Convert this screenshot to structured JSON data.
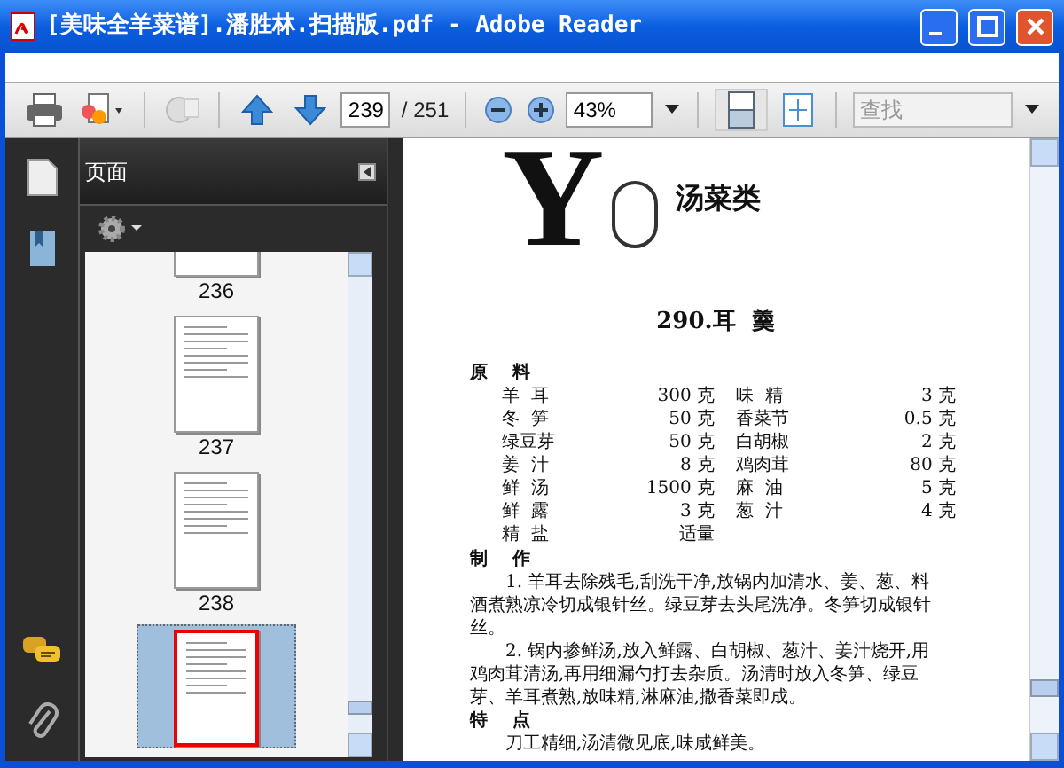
{
  "window": {
    "title": "[美味全羊菜谱].潘胜林.扫描版.pdf - Adobe Reader"
  },
  "toolbar": {
    "page": "239",
    "page_total": "/ 251",
    "zoom": "43%",
    "search": {
      "placeholder": "查找"
    }
  },
  "panel": {
    "title": "页面",
    "thumbnails": [
      {
        "label": "236",
        "selected": false
      },
      {
        "label": "237",
        "selected": false
      },
      {
        "label": "238",
        "selected": false
      },
      {
        "selected": true
      }
    ]
  },
  "document": {
    "initial": "Y",
    "section": "汤菜类",
    "recipe_title": "290.耳  羹",
    "ingredients_heading": "原    料",
    "ingredients": [
      [
        "羊  耳",
        "300 克",
        "味  精",
        "3 克"
      ],
      [
        "冬  笋",
        "50 克",
        "香菜节",
        "0.5 克"
      ],
      [
        "绿豆芽",
        "50 克",
        "白胡椒",
        "2 克"
      ],
      [
        "姜  汁",
        "8 克",
        "鸡肉茸",
        "80 克"
      ],
      [
        "鲜  汤",
        "1500 克",
        "麻  油",
        "5 克"
      ],
      [
        "鲜  露",
        "3 克",
        "葱  汁",
        "4 克"
      ],
      [
        "精  盐",
        "适量"
      ]
    ],
    "method_heading": "制    作",
    "steps": [
      "1. 羊耳去除残毛,刮洗干净,放锅内加清水、姜、葱、料酒煮熟凉冷切成银针丝。绿豆芽去头尾洗净。冬笋切成银针丝。",
      "2. 锅内掺鲜汤,放入鲜露、白胡椒、葱汁、姜汁烧开,用鸡肉茸清汤,再用细漏勺打去杂质。汤清时放入冬笋、绿豆芽、羊耳煮熟,放味精,淋麻油,撒香菜即成。"
    ],
    "feature_heading": "特    点",
    "feature": "刀工精细,汤清微见底,味咸鲜美。"
  }
}
